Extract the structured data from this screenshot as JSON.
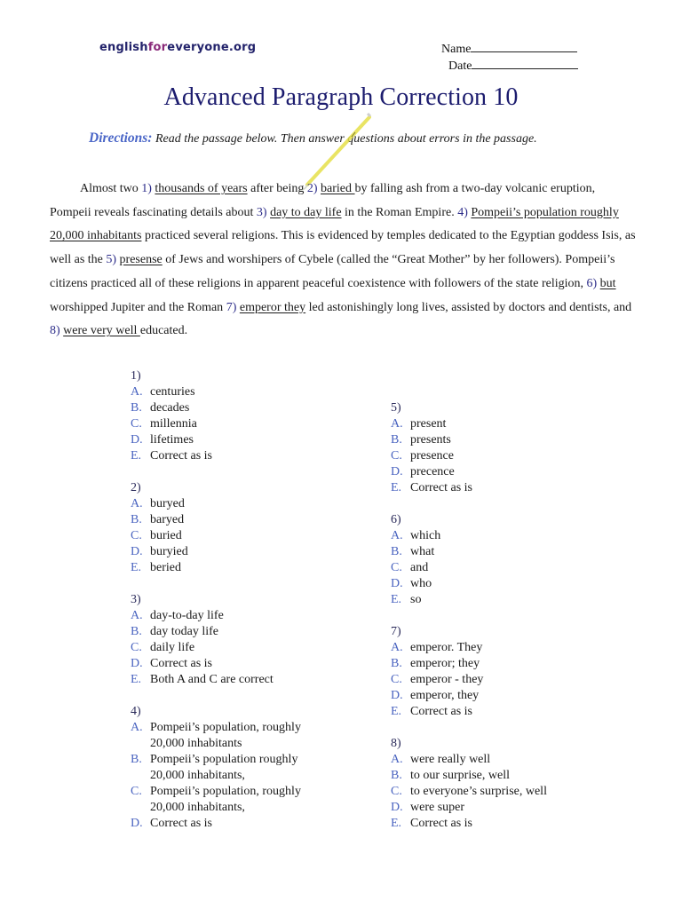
{
  "header": {
    "logo": {
      "pre": "english",
      "mid": "for",
      "post": "everyone.org"
    },
    "name_label": "Name",
    "date_label": "Date"
  },
  "title": "Advanced Paragraph Correction 10",
  "directions": {
    "label": "Directions:",
    "text": "Read the passage below. Then answer questions about errors in the passage."
  },
  "passage": {
    "segments": [
      {
        "t": "Almost two "
      },
      {
        "n": "1)"
      },
      {
        "t": " "
      },
      {
        "u": "thousands of years"
      },
      {
        "t": " after being "
      },
      {
        "n": "2)"
      },
      {
        "t": " "
      },
      {
        "u": "baried "
      },
      {
        "t": "by falling ash from a two-day volcanic eruption, Pompeii reveals fascinating details about "
      },
      {
        "n": "3)"
      },
      {
        "t": " "
      },
      {
        "u": "day to day life"
      },
      {
        "t": " in the Roman Empire. "
      },
      {
        "n": "4)"
      },
      {
        "t": " "
      },
      {
        "u": "Pompeii’s population roughly 20,000 inhabitants"
      },
      {
        "t": " practiced several religions. This is evidenced by temples dedicated to the Egyptian goddess Isis, as well as the "
      },
      {
        "n": "5)"
      },
      {
        "t": " "
      },
      {
        "u": "presense"
      },
      {
        "t": " of Jews and worshipers of Cybele (called the “Great Mother” by her followers). Pompeii’s citizens practiced all of these religions in apparent peaceful coexistence with followers of the state religion, "
      },
      {
        "n": "6)"
      },
      {
        "t": " "
      },
      {
        "u": "but"
      },
      {
        "t": " worshipped Jupiter and the Roman "
      },
      {
        "n": "7)"
      },
      {
        "t": " "
      },
      {
        "u": "emperor they"
      },
      {
        "t": " led astonishingly long lives, assisted by doctors and dentists, and "
      },
      {
        "n": "8)"
      },
      {
        "t": " "
      },
      {
        "u": "were very well "
      },
      {
        "t": "educated."
      }
    ]
  },
  "questions_left": [
    {
      "num": "1)",
      "choices": [
        {
          "letter": "A.",
          "text": "centuries"
        },
        {
          "letter": "B.",
          "text": "decades"
        },
        {
          "letter": "C.",
          "text": "millennia"
        },
        {
          "letter": "D.",
          "text": "lifetimes"
        },
        {
          "letter": "E.",
          "text": "Correct as is"
        }
      ]
    },
    {
      "num": "2)",
      "choices": [
        {
          "letter": "A.",
          "text": "buryed"
        },
        {
          "letter": "B.",
          "text": "baryed"
        },
        {
          "letter": "C.",
          "text": "buried"
        },
        {
          "letter": "D.",
          "text": "buryied"
        },
        {
          "letter": "E.",
          "text": "beried"
        }
      ]
    },
    {
      "num": "3)",
      "choices": [
        {
          "letter": "A.",
          "text": "day-to-day life"
        },
        {
          "letter": "B.",
          "text": "day today life"
        },
        {
          "letter": "C.",
          "text": "daily life"
        },
        {
          "letter": "D.",
          "text": "Correct as is"
        },
        {
          "letter": "E.",
          "text": "Both A and C are correct"
        }
      ]
    },
    {
      "num": "4)",
      "choices": [
        {
          "letter": "A.",
          "text": "Pompeii’s population, roughly 20,000 inhabitants"
        },
        {
          "letter": "B.",
          "text": "Pompeii’s population roughly 20,000 inhabitants,"
        },
        {
          "letter": "C.",
          "text": "Pompeii’s population, roughly 20,000 inhabitants,"
        },
        {
          "letter": "D.",
          "text": "Correct as is"
        }
      ]
    }
  ],
  "questions_right": [
    {
      "num": "5)",
      "choices": [
        {
          "letter": "A.",
          "text": "present"
        },
        {
          "letter": "B.",
          "text": "presents"
        },
        {
          "letter": "C.",
          "text": "presence"
        },
        {
          "letter": "D.",
          "text": "precence"
        },
        {
          "letter": "E.",
          "text": "Correct as is"
        }
      ]
    },
    {
      "num": "6)",
      "choices": [
        {
          "letter": "A.",
          "text": "which"
        },
        {
          "letter": "B.",
          "text": "what"
        },
        {
          "letter": "C.",
          "text": "and"
        },
        {
          "letter": "D.",
          "text": "who"
        },
        {
          "letter": "E.",
          "text": "so"
        }
      ]
    },
    {
      "num": "7)",
      "choices": [
        {
          "letter": "A.",
          "text": "emperor. They"
        },
        {
          "letter": "B.",
          "text": "emperor; they"
        },
        {
          "letter": "C.",
          "text": "emperor - they"
        },
        {
          "letter": "D.",
          "text": "emperor, they"
        },
        {
          "letter": "E.",
          "text": "Correct as is"
        }
      ]
    },
    {
      "num": "8)",
      "choices": [
        {
          "letter": "A.",
          "text": "were really well"
        },
        {
          "letter": "B.",
          "text": "to our surprise, well"
        },
        {
          "letter": "C.",
          "text": "to everyone’s surprise, well"
        },
        {
          "letter": "D.",
          "text": "were super"
        },
        {
          "letter": "E.",
          "text": "Correct as is"
        }
      ]
    }
  ],
  "colors": {
    "title": "#1c1c6e",
    "directions_label": "#4a66c7",
    "choice_letter": "#4a64c0",
    "logo_main": "#23236b",
    "logo_accent": "#8a2a7a"
  }
}
